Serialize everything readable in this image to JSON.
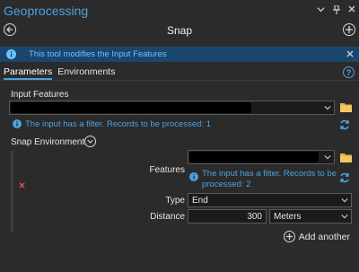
{
  "pane": {
    "title": "Geoprocessing",
    "controls": [
      "chevron-down",
      "pin",
      "close"
    ]
  },
  "tool": {
    "name": "Snap"
  },
  "banner": {
    "text": "This tool modifies the Input Features"
  },
  "tabs": [
    {
      "label": "Parameters",
      "active": true
    },
    {
      "label": "Environments",
      "active": false
    }
  ],
  "input_features": {
    "label": "Input Features",
    "message": "The input has a filter. Records to be processed: 1"
  },
  "snap_environment": {
    "label": "Snap Environment",
    "features_label": "Features",
    "features_message": "The input has a filter. Records to be processed: 2",
    "type_label": "Type",
    "type_value": "End",
    "distance_label": "Distance",
    "distance_value": "300",
    "unit_value": "Meters",
    "add_another": "Add another"
  },
  "colors": {
    "accent": "#4aa3e0",
    "banner_bg": "#1a466e",
    "panel_bg": "#2b2b2b",
    "error": "#d9534f"
  }
}
